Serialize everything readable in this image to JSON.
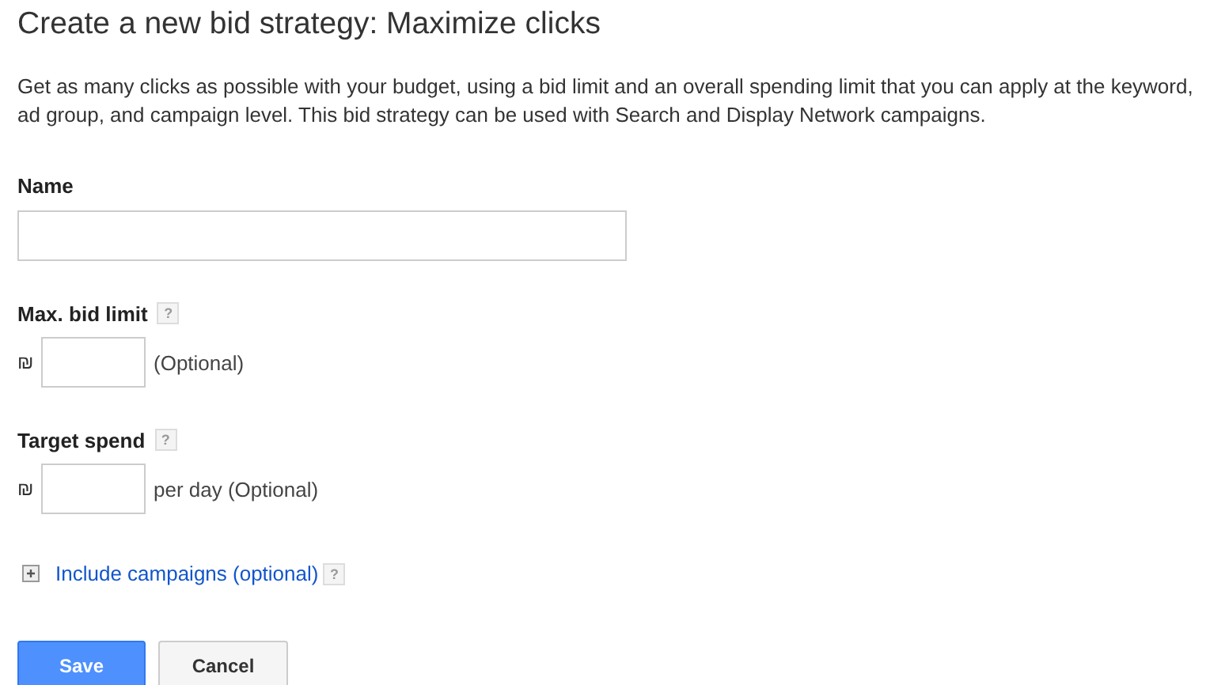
{
  "page": {
    "title": "Create a new bid strategy: Maximize clicks",
    "description": "Get as many clicks as possible with your budget, using a bid limit and an overall spending limit that you can apply at the keyword, ad group, and campaign level. This bid strategy can be used with Search and Display Network campaigns."
  },
  "fields": [
    {
      "kind": "text",
      "label": "Name"
    },
    {
      "kind": "money",
      "label": "Max. bid limit",
      "help": "?",
      "currency": "₪",
      "suffix": "(Optional)"
    },
    {
      "kind": "money",
      "label": "Target spend",
      "help": "?",
      "currency": "₪",
      "suffix": "per day (Optional)"
    }
  ],
  "expander": {
    "label": "Include campaigns (optional)",
    "help": "?",
    "expanded": false
  },
  "buttons": [
    {
      "label": "Save",
      "kind": "primary"
    },
    {
      "label": "Cancel",
      "kind": "secondary"
    }
  ]
}
